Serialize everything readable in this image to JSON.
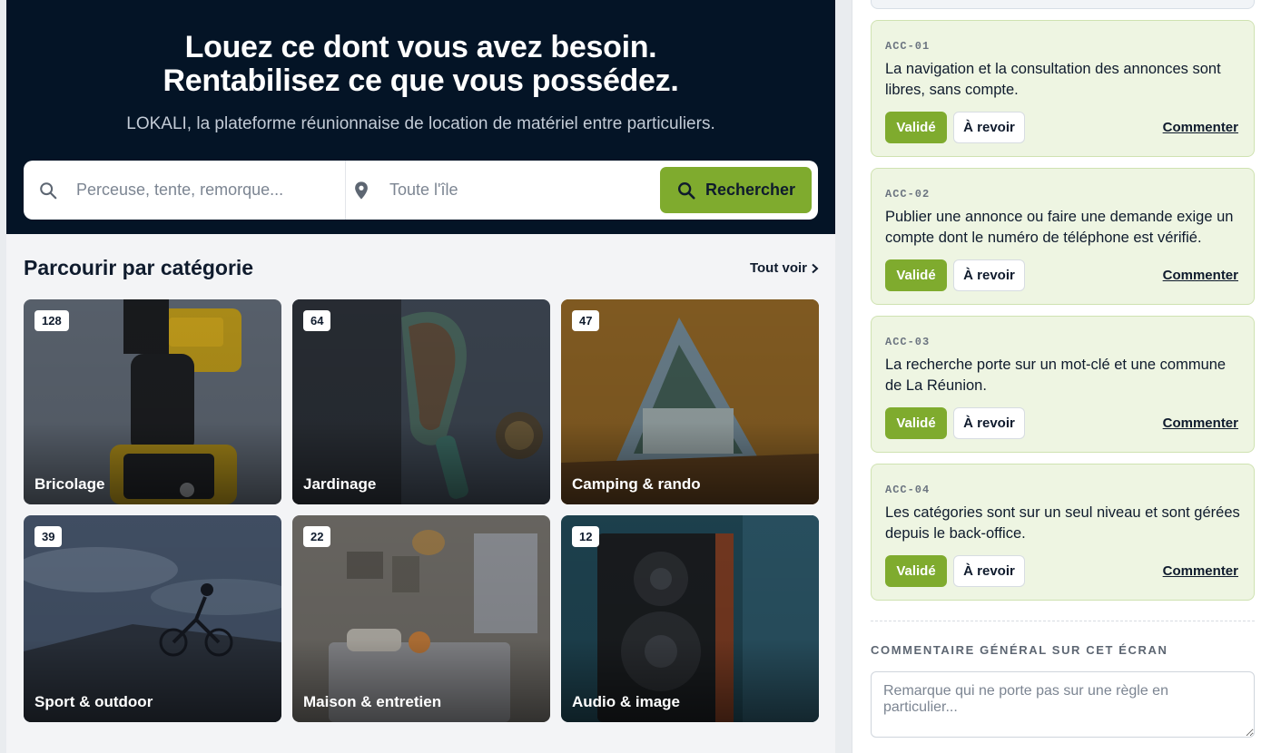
{
  "hero": {
    "title_line1": "Louez ce dont vous avez besoin.",
    "title_line2": "Rentabilisez ce que vous possédez.",
    "subtitle": "LOKALI, la plateforme réunionnaise de location de matériel entre particuliers."
  },
  "search": {
    "query_placeholder": "Perceuse, tente, remorque...",
    "location_placeholder": "Toute l'île",
    "button_label": "Rechercher"
  },
  "categories_section": {
    "title": "Parcourir par catégorie",
    "see_all": "Tout voir"
  },
  "categories": [
    {
      "label": "Bricolage",
      "count": "128"
    },
    {
      "label": "Jardinage",
      "count": "64"
    },
    {
      "label": "Camping & rando",
      "count": "47"
    },
    {
      "label": "Sport & outdoor",
      "count": "39"
    },
    {
      "label": "Maison & entretien",
      "count": "22"
    },
    {
      "label": "Audio & image",
      "count": "12"
    }
  ],
  "review": {
    "rules": [
      {
        "id": "ACC-01",
        "text": "La navigation et la consultation des annonces sont libres, sans compte.",
        "validate_label": "Validé",
        "review_label": "À revoir",
        "comment_label": "Commenter"
      },
      {
        "id": "ACC-02",
        "text": "Publier une annonce ou faire une demande exige un compte dont le numéro de téléphone est vérifié.",
        "validate_label": "Validé",
        "review_label": "À revoir",
        "comment_label": "Commenter"
      },
      {
        "id": "ACC-03",
        "text": "La recherche porte sur un mot-clé et une commune de La Réunion.",
        "validate_label": "Validé",
        "review_label": "À revoir",
        "comment_label": "Commenter"
      },
      {
        "id": "ACC-04",
        "text": "Les catégories sont sur un seul niveau et sont gérées depuis le back-office.",
        "validate_label": "Validé",
        "review_label": "À revoir",
        "comment_label": "Commenter"
      }
    ],
    "general_comment_label": "COMMENTAIRE GÉNÉRAL SUR CET ÉCRAN",
    "general_comment_placeholder": "Remarque qui ne porte pas sur une règle en particulier..."
  },
  "colors": {
    "hero_bg": "#041426",
    "accent_green": "#7fab2e",
    "rule_card_bg": "#eef5e2"
  }
}
